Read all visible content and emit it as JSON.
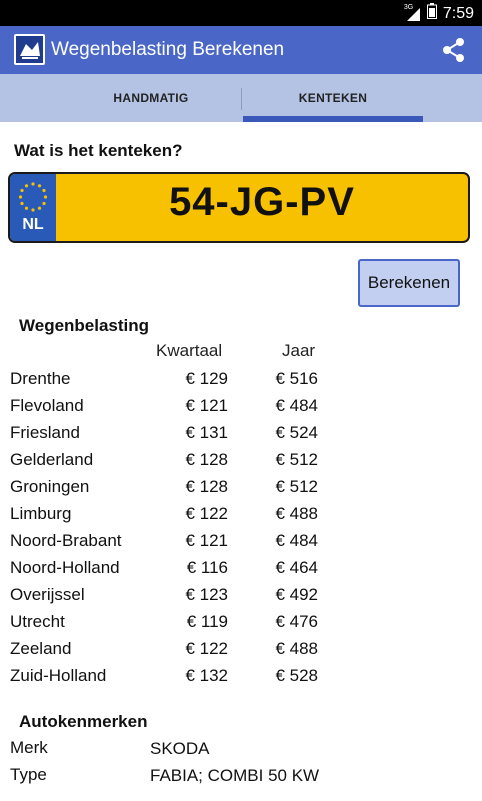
{
  "status": {
    "network": "3G",
    "time": "7:59"
  },
  "app": {
    "title": "Wegenbelasting Berekenen"
  },
  "tabs": [
    {
      "label": "HANDMATIG",
      "selected": false
    },
    {
      "label": "KENTEKEN",
      "selected": true
    }
  ],
  "question": "Wat is het kenteken?",
  "plate": {
    "country": "NL",
    "number": "54-JG-PV"
  },
  "calculate_label": "Berekenen",
  "tax": {
    "title": "Wegenbelasting",
    "col_quarter": "Kwartaal",
    "col_year": "Jaar",
    "rows": [
      {
        "province": "Drenthe",
        "quarter": "€ 129",
        "year": "€ 516"
      },
      {
        "province": "Flevoland",
        "quarter": "€ 121",
        "year": "€ 484"
      },
      {
        "province": "Friesland",
        "quarter": "€ 131",
        "year": "€ 524"
      },
      {
        "province": "Gelderland",
        "quarter": "€ 128",
        "year": "€ 512"
      },
      {
        "province": "Groningen",
        "quarter": "€ 128",
        "year": "€ 512"
      },
      {
        "province": "Limburg",
        "quarter": "€ 122",
        "year": "€ 488"
      },
      {
        "province": "Noord-Brabant",
        "quarter": "€ 121",
        "year": "€ 484"
      },
      {
        "province": "Noord-Holland",
        "quarter": "€ 116",
        "year": "€ 464"
      },
      {
        "province": "Overijssel",
        "quarter": "€ 123",
        "year": "€ 492"
      },
      {
        "province": "Utrecht",
        "quarter": "€ 119",
        "year": "€ 476"
      },
      {
        "province": "Zeeland",
        "quarter": "€ 122",
        "year": "€ 488"
      },
      {
        "province": "Zuid-Holland",
        "quarter": "€ 132",
        "year": "€ 528"
      }
    ]
  },
  "specs": {
    "title": "Autokenmerken",
    "brand_label": "Merk",
    "brand_value": "SKODA",
    "type_label": "Type",
    "type_value": "FABIA; COMBI 50 KW"
  },
  "colors": {
    "actionbar": "#4a66c6",
    "tabbar": "#b4c2e4",
    "plate": "#f7c100"
  }
}
